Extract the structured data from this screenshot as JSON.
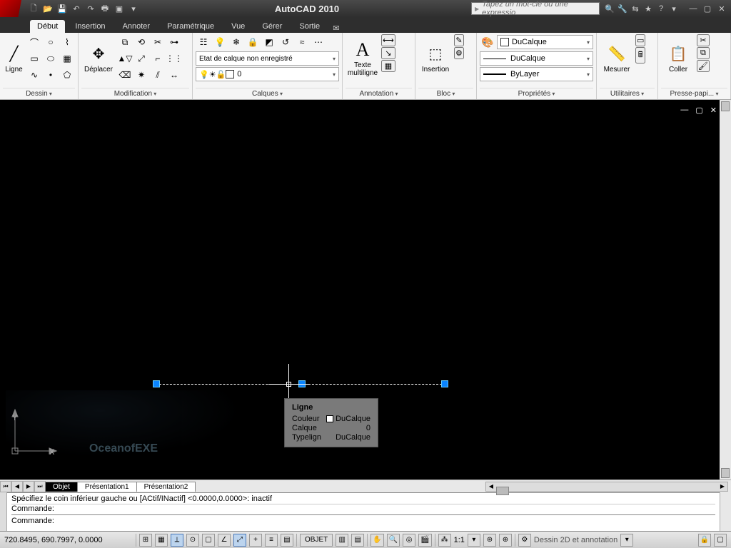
{
  "title": "AutoCAD 2010",
  "search_placeholder": "Tapez un mot-clé ou une expressio",
  "menu": {
    "tabs": [
      "Début",
      "Insertion",
      "Annoter",
      "Paramétrique",
      "Vue",
      "Gérer",
      "Sortie"
    ],
    "active": 0
  },
  "ribbon": {
    "dessin": {
      "title": "Dessin",
      "main": "Ligne"
    },
    "modif": {
      "title": "Modification",
      "main": "Déplacer"
    },
    "calques": {
      "title": "Calques",
      "state": "Etat de calque non enregistré",
      "current": "0"
    },
    "annot": {
      "title": "Annotation",
      "main": "Texte\nmultiligne"
    },
    "bloc": {
      "title": "Bloc",
      "main": "Insertion"
    },
    "prop": {
      "title": "Propriétés",
      "color": "DuCalque",
      "ltype": "DuCalque",
      "lweight": "ByLayer"
    },
    "util": {
      "title": "Utilitaires",
      "main": "Mesurer"
    },
    "clip": {
      "title": "Presse-papi...",
      "main": "Coller"
    }
  },
  "tooltip": {
    "title": "Ligne",
    "rows": [
      {
        "k": "Couleur",
        "v": "DuCalque",
        "swatch": true
      },
      {
        "k": "Calque",
        "v": "0"
      },
      {
        "k": "Typelign",
        "v": "DuCalque"
      }
    ]
  },
  "ucs": {
    "x": "X",
    "y": "Y"
  },
  "watermark": "OceanofEXE",
  "layout": {
    "tabs": [
      "Objet",
      "Présentation1",
      "Présentation2"
    ],
    "active": 0
  },
  "cmd": {
    "line1": "Spécifiez le coin inférieur gauche ou [ACtif/INactif] <0.0000,0.0000>: inactif",
    "line2": "Commande:",
    "line3": "Commande:"
  },
  "status": {
    "coords": "720.8495, 690.7997, 0.0000",
    "objet": "OBJET",
    "scale": "1:1",
    "ws": "Dessin 2D et annotation"
  }
}
